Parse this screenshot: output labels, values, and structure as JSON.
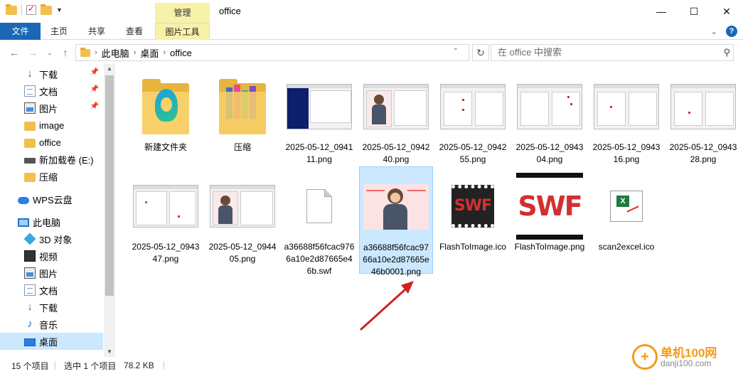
{
  "window": {
    "title": "office",
    "context_tab": "管理",
    "caption": {
      "minimize": "—",
      "maximize": "☐",
      "close": "✕"
    }
  },
  "ribbon": {
    "tabs": [
      "文件",
      "主页",
      "共享",
      "查看",
      "图片工具"
    ],
    "expand_icon": "chevron-down-icon",
    "help_icon": "?"
  },
  "address": {
    "crumbs": [
      "此电脑",
      "桌面",
      "office"
    ],
    "search_placeholder": "在 office 中搜索"
  },
  "nav": {
    "items": [
      {
        "label": "下载",
        "icon": "download-icon",
        "pinned": true
      },
      {
        "label": "文档",
        "icon": "document-icon",
        "pinned": true
      },
      {
        "label": "图片",
        "icon": "picture-icon",
        "pinned": true
      },
      {
        "label": "image",
        "icon": "folder-icon"
      },
      {
        "label": "office",
        "icon": "folder-icon"
      },
      {
        "label": "新加载卷 (E:)",
        "icon": "drive-icon"
      },
      {
        "label": "压缩",
        "icon": "folder-icon"
      },
      {
        "label": "WPS云盘",
        "icon": "cloud-icon"
      },
      {
        "label": "此电脑",
        "icon": "pc-icon"
      },
      {
        "label": "3D 对象",
        "icon": "3d-icon"
      },
      {
        "label": "视频",
        "icon": "video-icon"
      },
      {
        "label": "图片",
        "icon": "picture-icon"
      },
      {
        "label": "文档",
        "icon": "document-icon"
      },
      {
        "label": "下载",
        "icon": "download-icon"
      },
      {
        "label": "音乐",
        "icon": "music-icon"
      },
      {
        "label": "桌面",
        "icon": "desktop-icon",
        "selected": true
      }
    ]
  },
  "files": [
    {
      "name": "新建文件夹",
      "kind": "folder-edge"
    },
    {
      "name": "压缩",
      "kind": "folder-books"
    },
    {
      "name": "2025-05-12_094111.png",
      "kind": "shot-installer"
    },
    {
      "name": "2025-05-12_094240.png",
      "kind": "shot-woman"
    },
    {
      "name": "2025-05-12_094255.png",
      "kind": "shot-dialog"
    },
    {
      "name": "2025-05-12_094304.png",
      "kind": "shot-dialog"
    },
    {
      "name": "2025-05-12_094316.png",
      "kind": "shot-dialog"
    },
    {
      "name": "2025-05-12_094328.png",
      "kind": "shot-dialog"
    },
    {
      "name": "2025-05-12_094347.png",
      "kind": "shot-list"
    },
    {
      "name": "2025-05-12_094405.png",
      "kind": "shot-woman"
    },
    {
      "name": "a36688f56fcac9766a10e2d87665e46b.swf",
      "kind": "generic"
    },
    {
      "name": "a36688f56fcac9766a10e2d87665e46b0001.png",
      "kind": "woman-selected",
      "selected": true
    },
    {
      "name": "FlashToImage.ico",
      "kind": "swf-small"
    },
    {
      "name": "FlashToImage.png",
      "kind": "swf-big"
    },
    {
      "name": "scan2excel.ico",
      "kind": "excel"
    }
  ],
  "status": {
    "count": "15 个项目",
    "selection": "选中 1 个项目",
    "size": "78.2 KB"
  },
  "watermark": {
    "name": "单机100网",
    "url": "danji100.com"
  },
  "colors": {
    "accent": "#1a67b7",
    "selection": "#cce8ff",
    "context_tab": "#f7f2a8",
    "arrow": "#d42020"
  }
}
